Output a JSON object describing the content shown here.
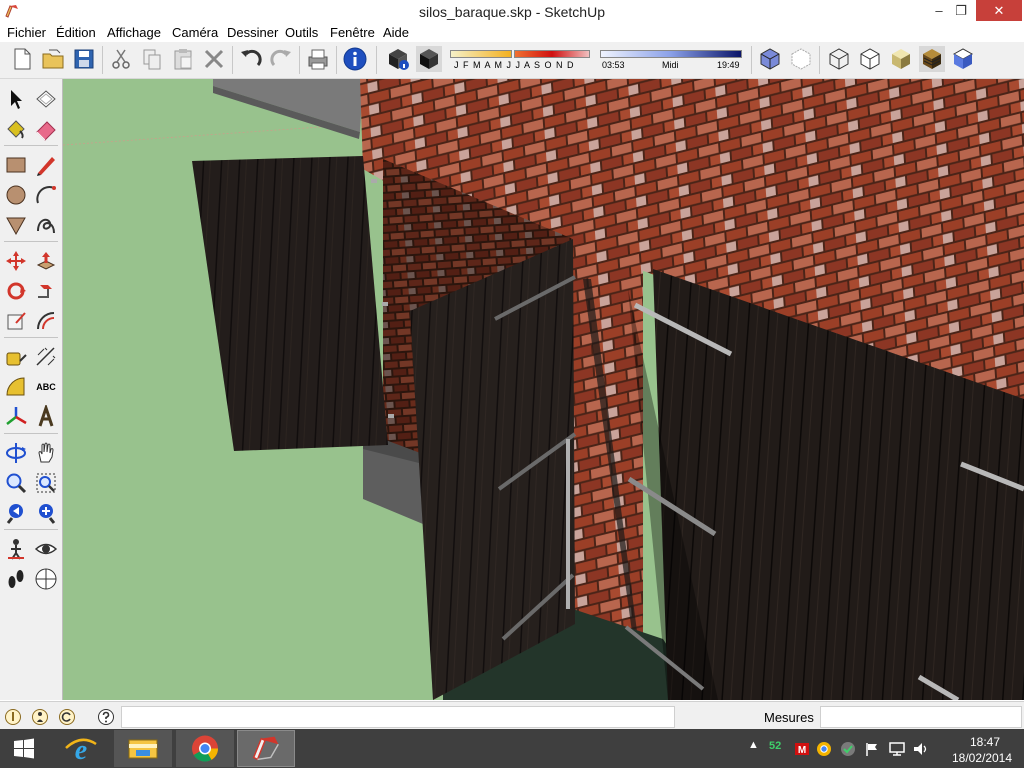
{
  "window": {
    "title": "silos_baraque.skp - SketchUp",
    "min": "–",
    "max": "❐",
    "close": "✕"
  },
  "menu": [
    "Fichier",
    "Édition",
    "Affichage",
    "Caméra",
    "Dessiner",
    "Outils",
    "Fenêtre",
    "Aide"
  ],
  "shadow": {
    "months": "J F M A M J J A S O N D",
    "time_start": "03:53",
    "midday": "Midi",
    "time_end": "19:49"
  },
  "palette_extra": {
    "text_tool": "ABC",
    "position_camera": "C"
  },
  "status": {
    "text": "",
    "measures_label": "Mesures",
    "measures_value": ""
  },
  "taskbar": {
    "tray_badge": "52",
    "time": "18:47",
    "date": "18/02/2014"
  },
  "colors": {
    "title_close": "#c7403a",
    "ground": "#98c28d",
    "brick": "#8a3a24",
    "wood": "#2a2320",
    "taskbar": "#3f3f3f"
  }
}
